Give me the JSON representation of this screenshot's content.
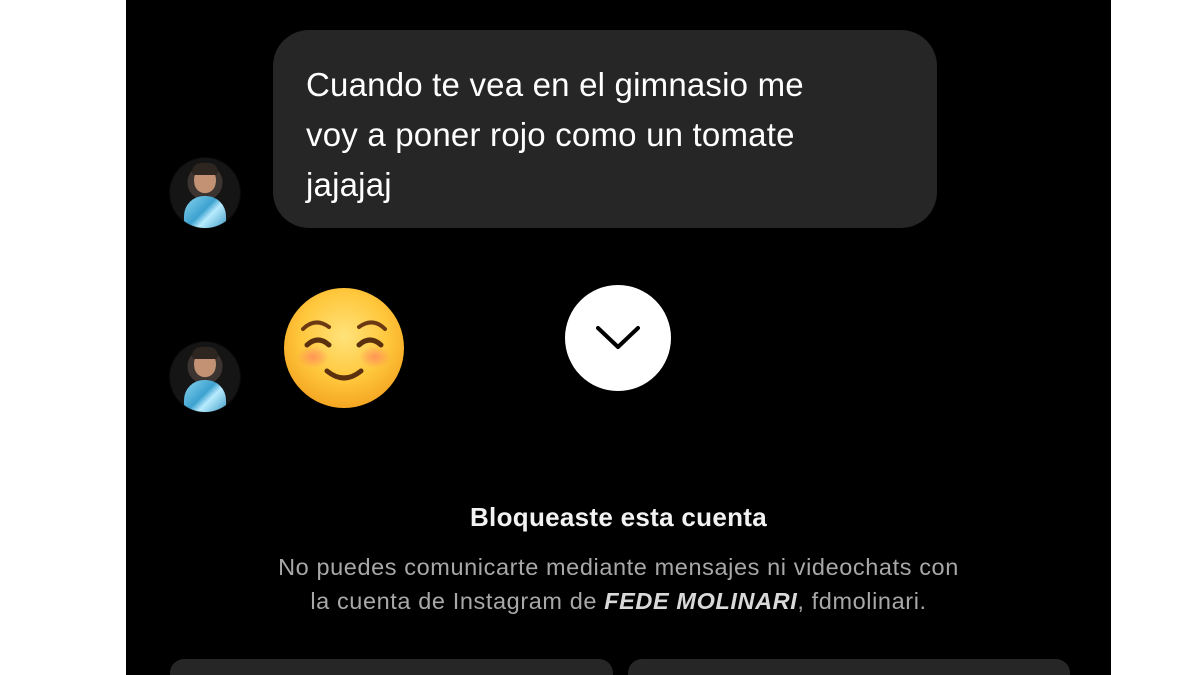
{
  "chat": {
    "incoming_message": {
      "lines": [
        "Cuando te vea en el gimnasio me",
        "voy a poner rojo como un tomate",
        "jajajaj"
      ]
    },
    "emoji_message": {
      "icon": "smiling-face-with-smiling-eyes-emoji"
    },
    "scroll_down_button": {
      "icon": "chevron-down-icon"
    }
  },
  "blocked_notice": {
    "title": "Bloqueaste esta cuenta",
    "description_line1": "No puedes comunicarte mediante mensajes ni videochats con",
    "description_prefix": "la cuenta de Instagram de",
    "account_display_name": "FEDE MOLINARI",
    "description_suffix": ", fdmolinari."
  },
  "colors": {
    "background": "#000000",
    "bubble": "#262626",
    "text_primary": "#ffffff",
    "text_secondary": "#a8a8a8"
  }
}
